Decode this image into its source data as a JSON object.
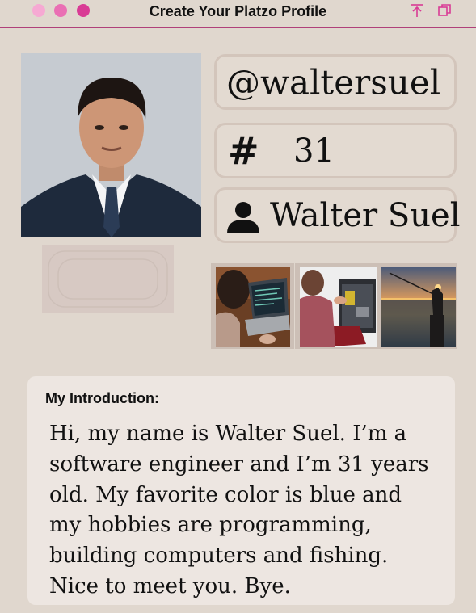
{
  "window": {
    "title": "Create Your Platzo Profile",
    "colors": {
      "accent": "#d93b95",
      "traffic_light": [
        "#f6a9d3",
        "#ea6fb4",
        "#d93b95"
      ]
    },
    "actions": [
      {
        "icon": "share-icon"
      },
      {
        "icon": "copy-icon"
      }
    ]
  },
  "profile": {
    "photo": {
      "description_icon": "profile-photo"
    },
    "username": "@waltersuel",
    "age_icon": "#",
    "age": "31",
    "name_icon": "person-icon",
    "name": "Walter Suel"
  },
  "hobbies": [
    {
      "icon": "programming-photo"
    },
    {
      "icon": "building-computers-photo"
    },
    {
      "icon": "fishing-photo"
    }
  ],
  "intro": {
    "label": "My Introduction:",
    "text": "Hi, my name is Walter Suel. I’m a software engineer and I’m 31 years old. My favorite color is blue and my hobbies are programming, building computers and fishing. Nice to meet you. Bye."
  }
}
